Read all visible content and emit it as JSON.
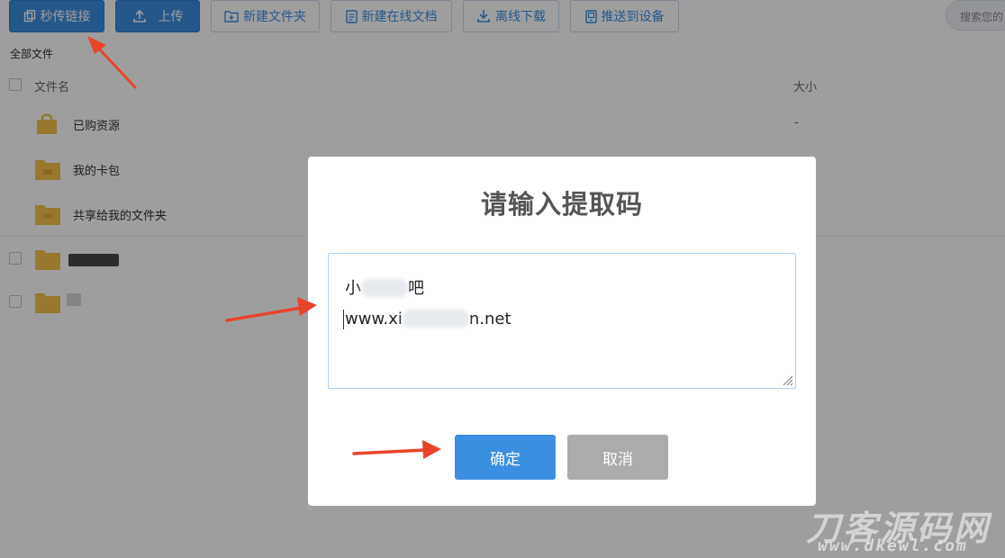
{
  "toolbar": {
    "instant_link": "秒传链接",
    "upload": "上传",
    "new_folder": "新建文件夹",
    "new_online_doc": "新建在线文档",
    "offline_download": "离线下载",
    "push_to_device": "推送到设备",
    "search_placeholder": "搜索您的"
  },
  "breadcrumb": "全部文件",
  "list": {
    "col_name": "文件名",
    "col_size": "大小",
    "rows": [
      {
        "name": "已购资源",
        "size": "-"
      },
      {
        "name": "我的卡包",
        "size": ""
      },
      {
        "name": "共享给我的文件夹",
        "size": ""
      }
    ]
  },
  "dialog": {
    "title": "请输入提取码",
    "code_line1": "小",
    "code_line1_end": "吧",
    "code_line2_start": "www.xi",
    "code_line2_end": "n.net",
    "confirm": "确定",
    "cancel": "取消"
  },
  "watermark": {
    "title": "刀客源码网",
    "url": "www.dkewl.com"
  },
  "colors": {
    "accent": "#3b8fe0",
    "folder": "#f3c34b",
    "annotation": "#e8442c"
  }
}
